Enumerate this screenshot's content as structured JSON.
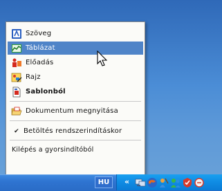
{
  "menu": {
    "items": [
      {
        "label": "Szöveg",
        "icon": "document-text-icon"
      },
      {
        "label": "Táblázat",
        "icon": "spreadsheet-icon",
        "highlighted": true
      },
      {
        "label": "Előadás",
        "icon": "presentation-icon"
      },
      {
        "label": "Rajz",
        "icon": "drawing-icon"
      },
      {
        "label": "Sablonból",
        "icon": "template-icon",
        "bold": true
      }
    ],
    "open_document": {
      "label": "Dokumentum megnyitása",
      "icon": "folder-open-icon"
    },
    "load_at_startup": {
      "label": "Betöltés rendszerindításkor",
      "checked": true,
      "check_glyph": "✔"
    },
    "exit_quickstarter": {
      "label": "Kilépés a gyorsindítóból"
    }
  },
  "taskbar": {
    "language": "HU",
    "overflow_glyph": "«",
    "tray_icons": [
      "network-icon",
      "globe-icon",
      "messenger-icon",
      "people-icon",
      "security-icon"
    ]
  },
  "colors": {
    "highlight": "#4f84c8",
    "taskbar": "#2f74d1",
    "tray": "#0f8be3"
  }
}
